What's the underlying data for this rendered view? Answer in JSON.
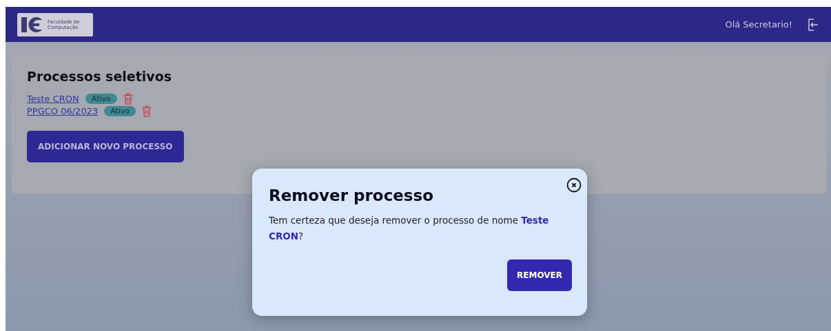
{
  "header": {
    "logo_text": [
      "Faculdade de",
      "Computação"
    ],
    "greeting": "Olá Secretario!"
  },
  "card": {
    "title": "Processos seletivos",
    "processes": [
      {
        "name": "Teste CRON",
        "status": "Ativo"
      },
      {
        "name": "PPGCO 06/2023",
        "status": "Ativo"
      }
    ],
    "add_button": "ADICIONAR NOVO PROCESSO"
  },
  "dialog": {
    "title": "Remover processo",
    "message": "Tem certeza que deseja remover o processo de nome **Teste CRON**?",
    "button": "REMOVER"
  }
}
